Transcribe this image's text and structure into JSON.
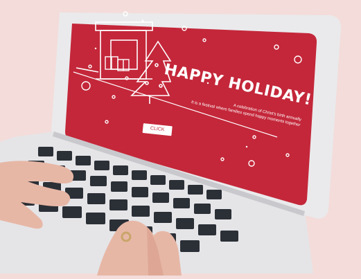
{
  "screen": {
    "headline": "HAPPY HOLIDAY!",
    "description_line1": "A celebration of Christ's birth annually",
    "description_line2": "It is a festival where families spend happy moments together",
    "cta_label": "CLICK"
  },
  "colors": {
    "background": "#f3dcda",
    "screen_red": "#c4273a",
    "laptop_body": "#e8e8ea",
    "keys": "#2b2f36",
    "skin": "#e7b7a6"
  },
  "icons": {
    "fireplace": "fireplace-icon",
    "tree": "christmas-tree-icon",
    "gifts": "gift-icon",
    "snow": "snowflake-dots"
  }
}
